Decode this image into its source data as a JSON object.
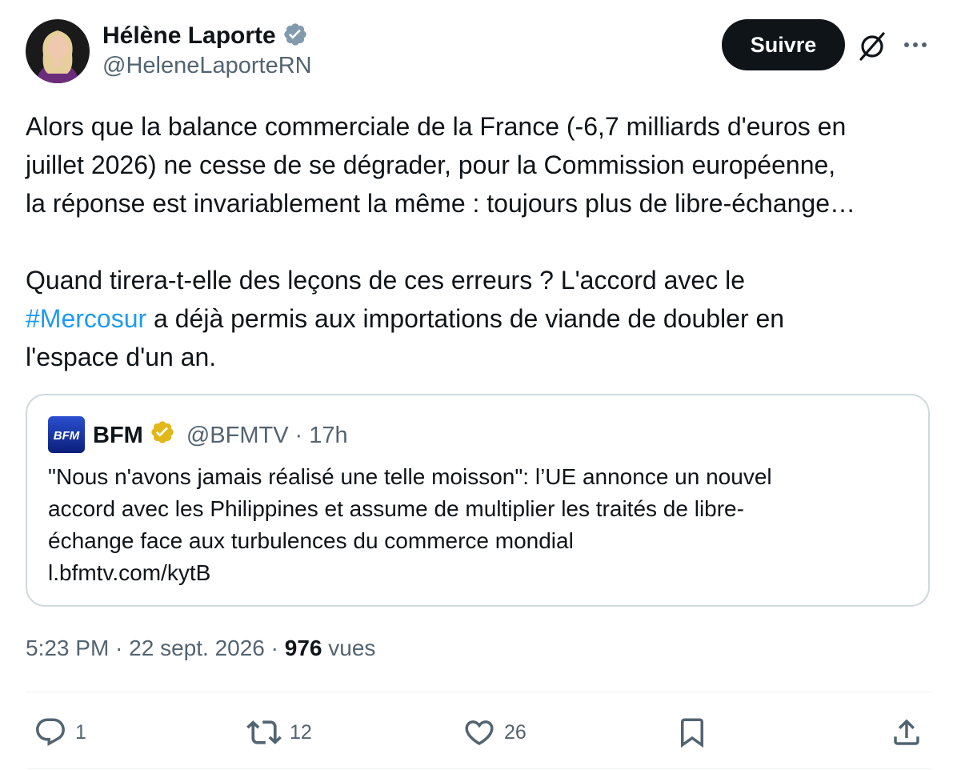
{
  "author": {
    "name": "Hélène Laporte",
    "handle": "@HeleneLaporteRN",
    "verified_color": "#829aab"
  },
  "header": {
    "follow_label": "Suivre",
    "grok_icon": "grok-icon",
    "more_icon": "more-icon"
  },
  "tweet": {
    "line1": "Alors que la balance commerciale de la France (-6,7 milliards d'euros en",
    "line2": "juillet 2026) ne cesse de se dégrader, pour la Commission européenne,",
    "line3": "la réponse est invariablement la même : toujours plus de libre-échange…",
    "line4": "Quand tirera-t-elle des leçons de ces erreurs ? L'accord avec le",
    "hashtag": "#Mercosur",
    "line5_rest": " a déjà permis aux importations de viande de doubler en",
    "line6": "l'espace d'un an."
  },
  "quote": {
    "logo_text": "BFM",
    "name": "BFM",
    "handle": "@BFMTV",
    "sep": "·",
    "time": "17h",
    "badge_color": "#e2b719",
    "line1": "\"Nous n'avons jamais réalisé une telle moisson\": l’UE annonce un nouvel",
    "line2": "accord avec les Philippines et assume de multiplier les traités de libre-",
    "line3": "échange face aux turbulences du commerce mondial",
    "link": "l.bfmtv.com/kytB"
  },
  "meta": {
    "time": "5:23 PM",
    "sep1": " · ",
    "date": "22 sept. 2026",
    "sep2": " · ",
    "views_count": "976",
    "views_label": " vues"
  },
  "actions": {
    "replies": "1",
    "reposts": "12",
    "likes": "26"
  },
  "colors": {
    "link": "#1d9bf0",
    "text": "#0f1419",
    "secondary": "#536471",
    "border": "#cfd9de"
  }
}
